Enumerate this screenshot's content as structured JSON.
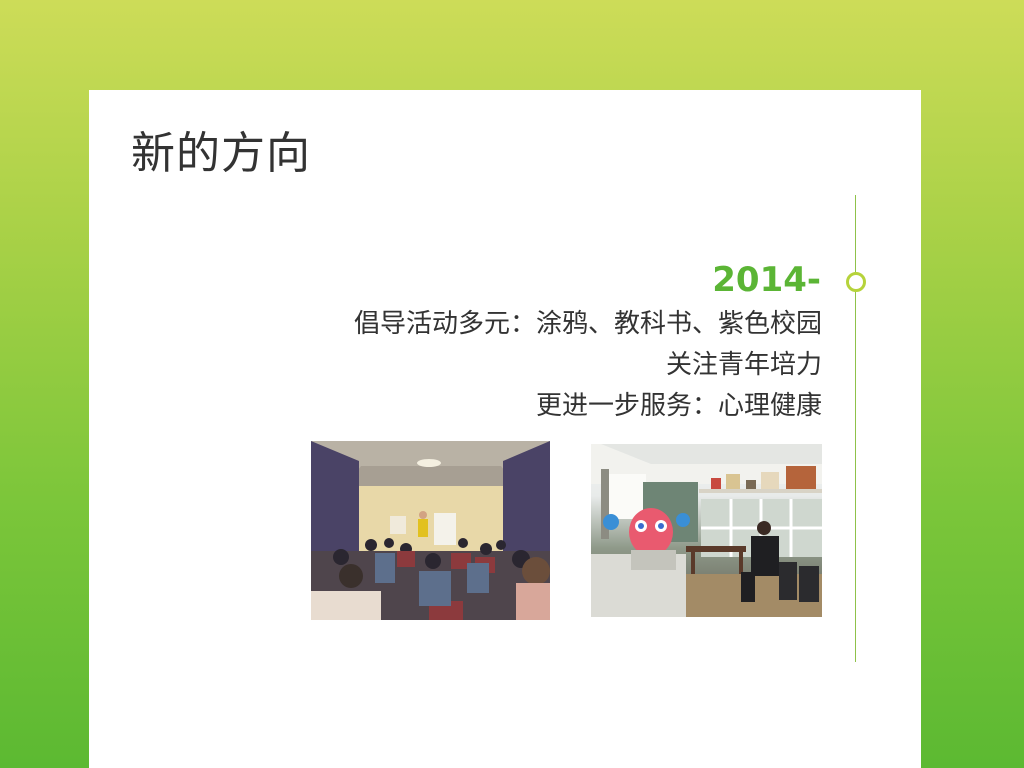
{
  "slide": {
    "title": "新的方向",
    "year": "2014-",
    "lines": [
      "倡导活动多元：涂鸦、教科书、紫色校园",
      "关注青年培力",
      "更进一步服务：心理健康"
    ]
  },
  "colors": {
    "background_top": "#cddc58",
    "background_bottom": "#5cb932",
    "card": "#ffffff",
    "title_text": "#333333",
    "year_text": "#5bb535",
    "timeline_line": "#8fc24a",
    "timeline_dot": "#b6d33b"
  },
  "images": [
    {
      "name": "meeting-room-photo",
      "description_icon": "photo-icon"
    },
    {
      "name": "counseling-room-photo",
      "description_icon": "photo-icon"
    }
  ]
}
